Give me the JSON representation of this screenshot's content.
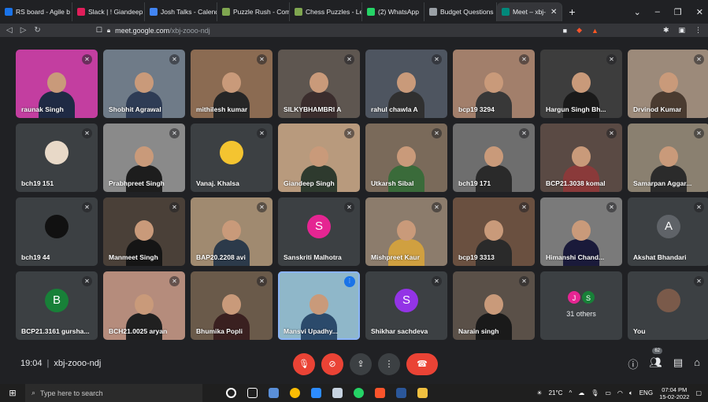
{
  "browser": {
    "tabs": [
      {
        "label": "RS board - Agile b",
        "color": "#1a73e8"
      },
      {
        "label": "Slack | ! Giandeep",
        "color": "#e01e5a"
      },
      {
        "label": "Josh Talks - Calend",
        "color": "#4285f4"
      },
      {
        "label": "Puzzle Rush - Com",
        "color": "#7fa650"
      },
      {
        "label": "Chess Puzzles - Le",
        "color": "#7fa650"
      },
      {
        "label": "(2) WhatsApp",
        "color": "#25d366"
      },
      {
        "label": "Budget Questions",
        "color": "#9aa0a6"
      },
      {
        "label": "Meet – xbj-",
        "color": "#00897b",
        "active": true
      }
    ],
    "url_host": "meet.google.com",
    "url_path": "/xbj-zooo-ndj",
    "window_controls": [
      "chevron-down-icon",
      "minimize-icon",
      "restore-icon",
      "close-icon"
    ]
  },
  "participants": [
    {
      "name": "raunak Singh",
      "bg": "#c33ea0",
      "type": "video",
      "shirt": "#1f2a44"
    },
    {
      "name": "Shobhit Agrawal",
      "bg": "#6f7b88",
      "type": "video",
      "shirt": "#2e3c55"
    },
    {
      "name": "mithilesh kumar",
      "bg": "#8b6b52",
      "type": "video",
      "shirt": "#262626"
    },
    {
      "name": "SILKYBHAMBRI A",
      "bg": "#5e5650",
      "type": "video",
      "shirt": "#3b2d2d"
    },
    {
      "name": "rahul chawla A",
      "bg": "#4e5560",
      "type": "video",
      "shirt": "#303030"
    },
    {
      "name": "bcp19 3294",
      "bg": "#a27f6b",
      "type": "video",
      "shirt": "#383838"
    },
    {
      "name": "Hargun Singh Bh...",
      "bg": "#3d3d3d",
      "type": "video",
      "shirt": "#1a1a1a"
    },
    {
      "name": "Drvinod Kumar",
      "bg": "#9c8a7a",
      "type": "video",
      "shirt": "#4a3b30"
    },
    {
      "name": "bch19 151",
      "bg": "#3c4043",
      "type": "logo",
      "logo_color": "#e8d9c8"
    },
    {
      "name": "Prabhpreet Singh",
      "bg": "#8a8a8a",
      "type": "video",
      "shirt": "#1d1d1d"
    },
    {
      "name": "Vanaj. Khalsa",
      "bg": "#3c4043",
      "type": "logo",
      "logo_color": "#f4c430"
    },
    {
      "name": "Giandeep Singh",
      "bg": "#b89a7d",
      "type": "video",
      "shirt": "#2e3a2e"
    },
    {
      "name": "Utkarsh Sibal",
      "bg": "#7a6a5a",
      "type": "video",
      "shirt": "#3a6b3a"
    },
    {
      "name": "bch19 171",
      "bg": "#6e6e6e",
      "type": "video",
      "shirt": "#2a2a2a"
    },
    {
      "name": "BCP21.3038 komal",
      "bg": "#5a4a44",
      "type": "video",
      "shirt": "#8a3a3a"
    },
    {
      "name": "Samarpan Aggar...",
      "bg": "#8a8070",
      "type": "video",
      "shirt": "#2b2b2b"
    },
    {
      "name": "bch19 44",
      "bg": "#3c4043",
      "type": "logo",
      "logo_color": "#111111"
    },
    {
      "name": "Manmeet Singh",
      "bg": "#4a4038",
      "type": "video",
      "shirt": "#151515"
    },
    {
      "name": "BAP20.2208 avi",
      "bg": "#a08a70",
      "type": "video",
      "shirt": "#2c3a4a"
    },
    {
      "name": "Sanskriti Malhotra",
      "bg": "#3c4043",
      "type": "avatar",
      "letter": "S",
      "avatar_color": "#e52592"
    },
    {
      "name": "Mishpreet Kaur",
      "bg": "#8c7c6c",
      "type": "video",
      "shirt": "#d0a040"
    },
    {
      "name": "bcp19 3313",
      "bg": "#6a5040",
      "type": "video",
      "shirt": "#2a2a2a"
    },
    {
      "name": "Himanshi Chand...",
      "bg": "#7a7a7a",
      "type": "video",
      "shirt": "#1a1a3a"
    },
    {
      "name": "Akshat Bhandari",
      "bg": "#3c4043",
      "type": "avatar",
      "letter": "A",
      "avatar_color": "#5f6368"
    },
    {
      "name": "BCP21.3161 gursha...",
      "bg": "#3c4043",
      "type": "avatar",
      "letter": "B",
      "avatar_color": "#188038"
    },
    {
      "name": "BCH21.0025 aryan",
      "bg": "#b58c7c",
      "type": "video",
      "shirt": "#202020"
    },
    {
      "name": "Bhumika Popli",
      "bg": "#6a5a4a",
      "type": "video",
      "shirt": "#3a2020"
    },
    {
      "name": "Mansvi Upadhy...",
      "bg": "#8fb7c9",
      "type": "video",
      "shirt": "#2b4a6b",
      "speaking": true
    },
    {
      "name": "Shikhar sachdeva",
      "bg": "#3c4043",
      "type": "avatar",
      "letter": "S",
      "avatar_color": "#9334e6"
    },
    {
      "name": "Narain singh",
      "bg": "#5a5048",
      "type": "video",
      "shirt": "#1a1a1a"
    },
    {
      "name": "",
      "bg": "#3c4043",
      "type": "others",
      "label": "31 others",
      "initials": [
        {
          "letter": "J",
          "color": "#e52592"
        },
        {
          "letter": "S",
          "color": "#188038"
        }
      ]
    },
    {
      "name": "You",
      "bg": "#3c4043",
      "type": "logo",
      "logo_color": "#7a5a4a"
    }
  ],
  "controls": {
    "time": "19:04",
    "meeting_code": "xbj-zooo-ndj",
    "people_count": "62"
  },
  "taskbar": {
    "search_placeholder": "Type here to search",
    "temperature": "21°C",
    "language": "ENG",
    "time": "07:04 PM",
    "date": "15-02-2022"
  }
}
